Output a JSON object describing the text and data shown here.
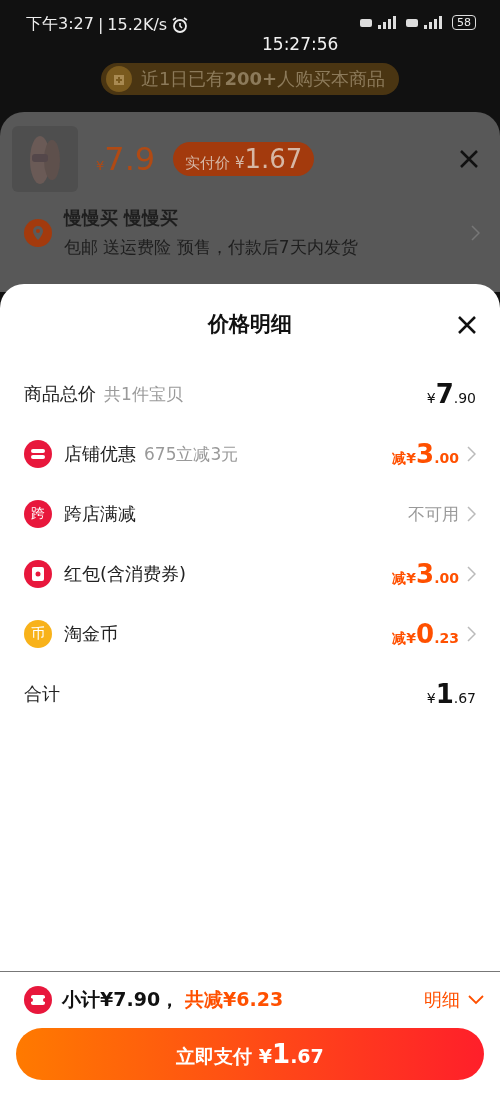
{
  "status_bar": {
    "time": "下午3:27",
    "separator": "|",
    "speed": "15.2K/s",
    "battery": "58",
    "clock": "15:27:56"
  },
  "background": {
    "banner": "近1日已有**200+**人购买本商品"
  },
  "product_sheet": {
    "price_currency": "¥",
    "price": "7.9",
    "paid_label": "实付价 ¥",
    "paid_value": "1.67",
    "address_name": "慢慢买 慢慢买",
    "address_detail": "包邮 送运费险 预售，付款后7天内发货"
  },
  "price_detail": {
    "title": "价格明细",
    "rows": [
      {
        "kind": "plain",
        "label": "商品总价",
        "note": "共1件宝贝",
        "prefix": "¥",
        "integer": "7",
        "decimals": ".90",
        "chevron": false
      },
      {
        "kind": "shop",
        "label": "店铺优惠",
        "note": "675立减3元",
        "prefix": "减¥",
        "integer": "3",
        "decimals": ".00",
        "discount": true,
        "chevron": true
      },
      {
        "kind": "cross",
        "icon_text": "跨",
        "label": "跨店满减",
        "status": "不可用",
        "chevron": true
      },
      {
        "kind": "redpacket",
        "label": "红包(含消费券)",
        "prefix": "减¥",
        "integer": "3",
        "decimals": ".00",
        "discount": true,
        "chevron": true
      },
      {
        "kind": "coin",
        "icon_text": "币",
        "label": "淘金币",
        "prefix": "减¥",
        "integer": "0",
        "decimals": ".23",
        "discount": true,
        "chevron": true
      },
      {
        "kind": "plain",
        "label": "合计",
        "prefix": "¥",
        "integer": "1",
        "decimals": ".67",
        "chevron": false
      }
    ]
  },
  "footer": {
    "subtotal": "小计¥7.90，",
    "savings": "共减¥6.23",
    "detail_link": "明细",
    "pay_button": "立即支付 ¥",
    "pay_integer": "1",
    "pay_decimals": ".67"
  }
}
